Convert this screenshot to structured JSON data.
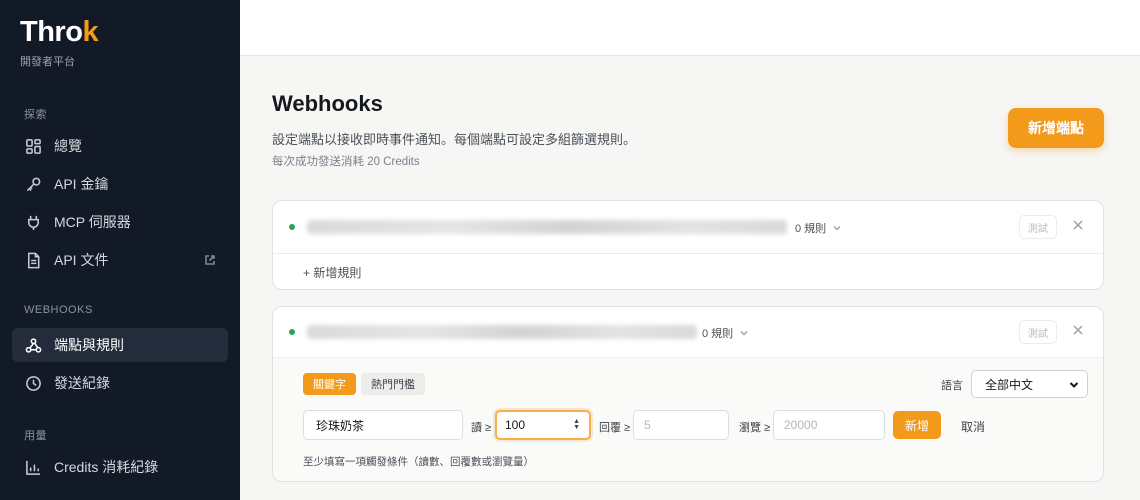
{
  "sidebar": {
    "brand": "Throk",
    "brand_mark": "k",
    "brand_sub": "開發者平台",
    "sections": [
      {
        "label": "探索"
      },
      {
        "label": "WEBHOOKS"
      },
      {
        "label": "用量"
      }
    ],
    "items": [
      {
        "label": "總覽",
        "icon": "grid-icon"
      },
      {
        "label": "API 金鑰",
        "icon": "key-icon"
      },
      {
        "label": "MCP 伺服器",
        "icon": "plug-icon"
      },
      {
        "label": "API 文件",
        "icon": "document-icon"
      },
      {
        "label": "端點與規則",
        "icon": "webhook-icon",
        "active": true
      },
      {
        "label": "發送紀錄",
        "icon": "clock-icon"
      },
      {
        "label": "Credits 消耗紀錄",
        "icon": "bar-chart-icon"
      }
    ]
  },
  "main": {
    "title": "Webhooks",
    "description": "設定端點以接收即時事件通知。每個端點可設定多組篩選規則。",
    "cost_note": "每次成功發送消耗 20 Credits",
    "add_endpoint_label": "新增端點"
  },
  "endpoints": [
    {
      "rule_count": "0 規則",
      "test_label": "測試",
      "add_rule_label": "+ 新增規則"
    },
    {
      "rule_count": "0 規則",
      "test_label": "測試",
      "tabs": [
        "關鍵字",
        "熱門門檻"
      ],
      "language_label": "語言",
      "language_value": "全部中文",
      "keyword_value": "珍珠奶茶",
      "reads_label": "讀 ≥",
      "reads_value": "100",
      "replies_label": "回覆 ≥",
      "replies_placeholder": "5",
      "views_label": "瀏覽 ≥",
      "views_placeholder": "20000",
      "add_label": "新增",
      "cancel_label": "取消",
      "hint": "至少填寫一項觸發條件（讀數、回覆數或瀏覽量）"
    }
  ],
  "colors": {
    "accent": "#f39a1a",
    "sidebar_bg": "#131a27",
    "status_active": "#22a559"
  }
}
